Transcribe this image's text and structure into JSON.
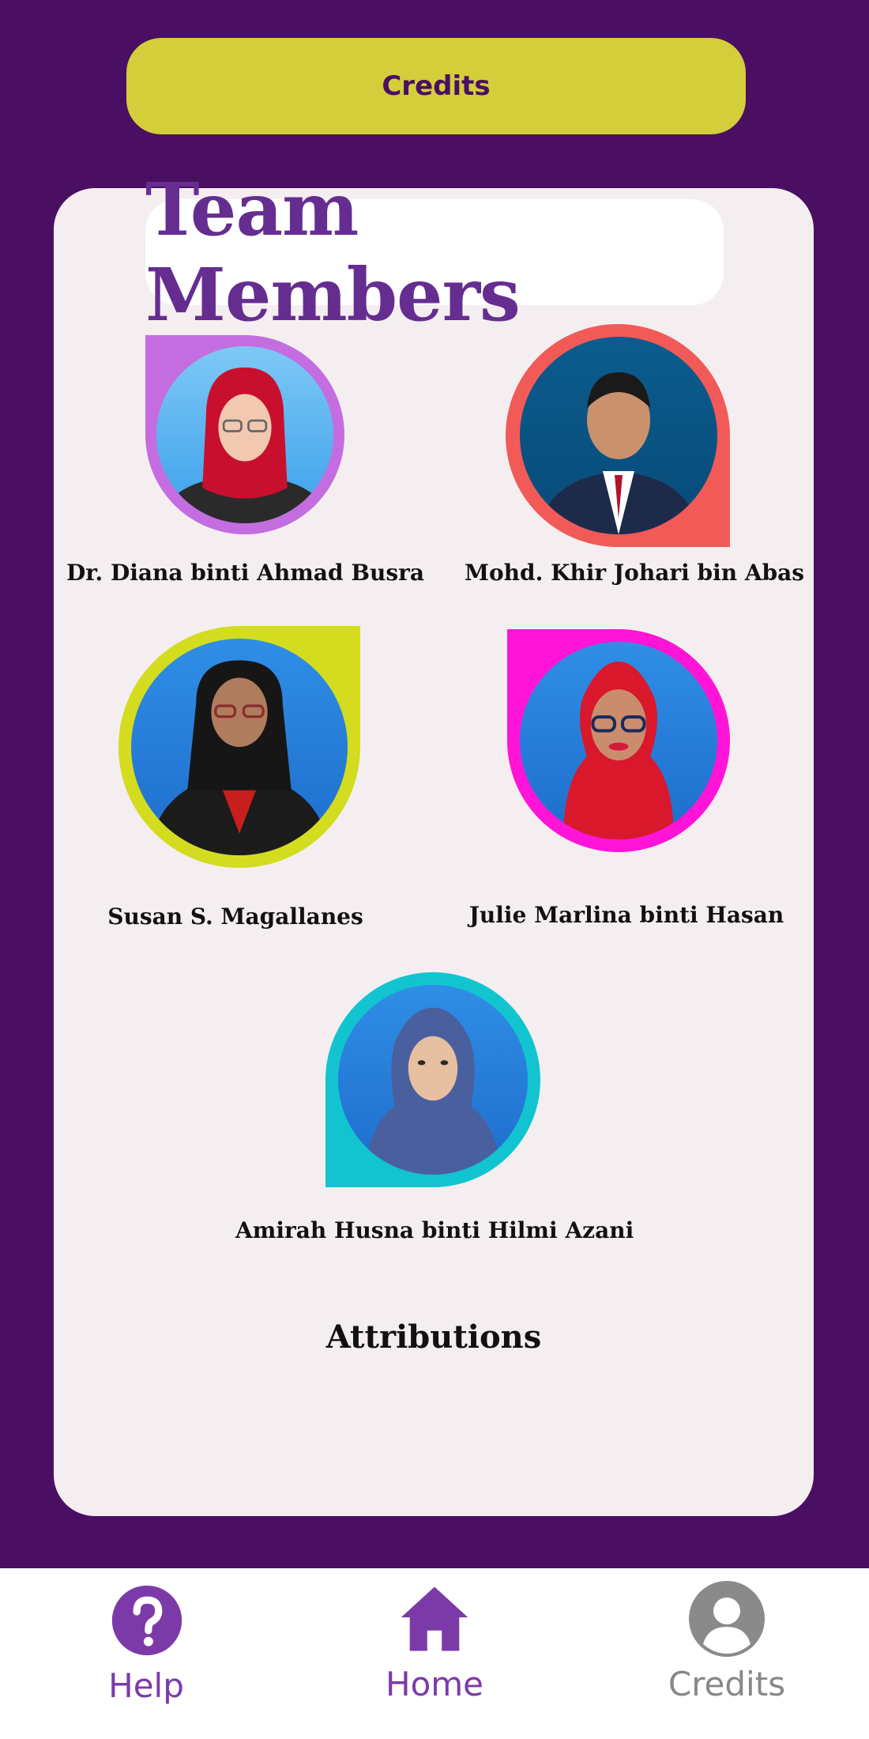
{
  "header": {
    "button_label": "Credits"
  },
  "card": {
    "title": "Team Members",
    "attributions_heading": "Attributions"
  },
  "members": [
    {
      "name": "Dr. Diana binti Ahmad Busra",
      "frame_color": "#c46de0",
      "icon": "portrait-photo"
    },
    {
      "name": "Mohd. Khir Johari bin Abas",
      "frame_color": "#f25a57",
      "icon": "portrait-photo"
    },
    {
      "name": "Susan S. Magallanes",
      "frame_color": "#d3dc1f",
      "icon": "portrait-photo"
    },
    {
      "name": "Julie Marlina binti Hasan",
      "frame_color": "#ff14d8",
      "icon": "portrait-photo"
    },
    {
      "name": "Amirah Husna binti Hilmi Azani",
      "frame_color": "#12c4cf",
      "icon": "portrait-photo"
    }
  ],
  "bottom_nav": {
    "items": [
      {
        "label": "Help",
        "icon": "help-icon",
        "color": "#7c3aa8"
      },
      {
        "label": "Home",
        "icon": "home-icon",
        "color": "#7c3aa8"
      },
      {
        "label": "Credits",
        "icon": "user-icon",
        "color": "#888888"
      }
    ]
  },
  "colors": {
    "background": "#4a0f62",
    "accent_yellow": "#d4ce3a",
    "title_purple": "#662d91",
    "card_bg": "#f5eef1"
  }
}
